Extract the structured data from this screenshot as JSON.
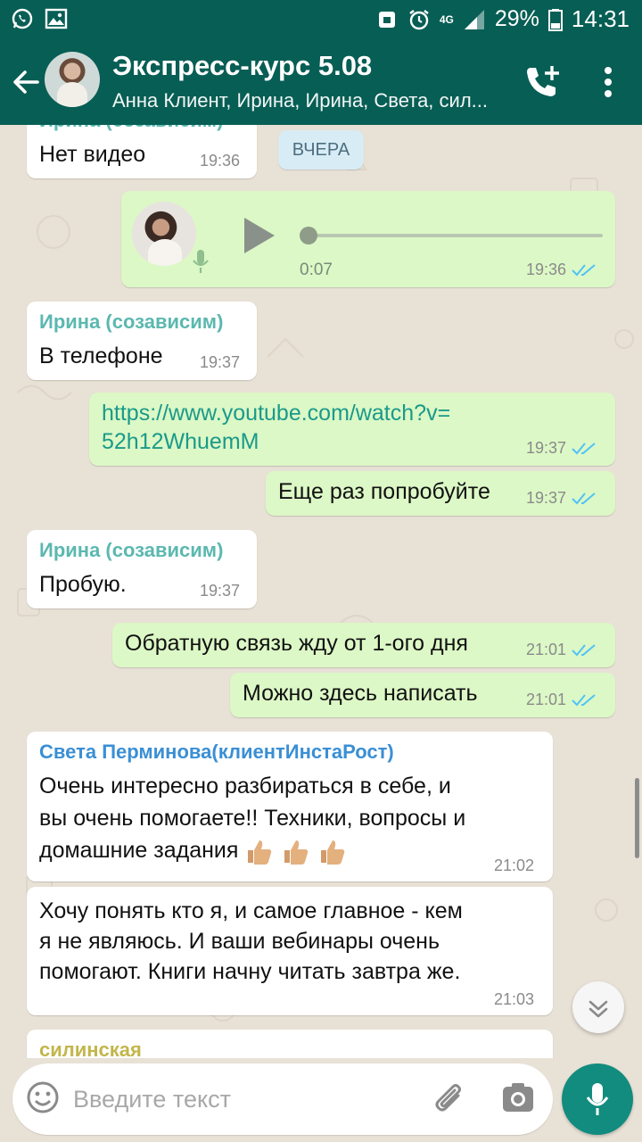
{
  "statusbar": {
    "network": "4G",
    "battery": "29%",
    "time": "14:31"
  },
  "header": {
    "title": "Экспресс-курс 5.08",
    "subtitle": "Анна Клиент, Ирина, Ирина, Света, сил..."
  },
  "date_chip": "ВЧЕРА",
  "messages": [
    {
      "type": "in",
      "sender": "Ирина (созависим)",
      "text": "Нет видео",
      "time": "19:36"
    },
    {
      "type": "out-voice",
      "duration": "0:07",
      "time": "19:36"
    },
    {
      "type": "in",
      "sender": "Ирина (созависим)",
      "text": "В телефоне",
      "time": "19:37"
    },
    {
      "type": "out",
      "text_line1": "https://www.youtube.com/watch?v=",
      "text_line2": "52h12WhuemM",
      "time": "19:37"
    },
    {
      "type": "out",
      "text": "Еще раз попробуйте",
      "time": "19:37"
    },
    {
      "type": "in",
      "sender": "Ирина (созависим)",
      "text": "Пробую.",
      "time": "19:37"
    },
    {
      "type": "out",
      "text": "Обратную связь жду от 1-ого дня",
      "time": "21:01"
    },
    {
      "type": "out",
      "text": "Можно здесь написать",
      "time": "21:01"
    },
    {
      "type": "in",
      "sender": "Света Перминова(клиентИнстаРост)",
      "line1": "Очень интересно разбираться в себе, и",
      "line2": "вы очень помогаете!! Техники, вопросы и",
      "line3": "домашние задания",
      "time": "21:02"
    },
    {
      "type": "in",
      "line1": "Хочу понять кто я, и самое главное - кем",
      "line2": "я не являюсь. И ваши вебинары очень",
      "line3": "помогают. Книги начну читать завтра же.",
      "time": "21:03"
    },
    {
      "type": "in",
      "sender": "силинская"
    }
  ],
  "colors": {
    "header": "#075e54",
    "outgoing": "#dcf8c6",
    "incoming": "#ffffff",
    "sender_irina": "#5bb8b0",
    "sender_sveta": "#3a8fd4",
    "sender_silinskaya": "#c2b64b",
    "ticks": "#4fc3f7"
  },
  "input": {
    "placeholder": "Введите текст"
  },
  "icons": [
    "whatsapp-icon",
    "gallery-icon",
    "back-arrow-icon",
    "add-call-icon",
    "more-vert-icon",
    "play-icon",
    "mic-icon",
    "emoji-icon",
    "attach-icon",
    "camera-icon",
    "chevron-down-icon",
    "thumbs-up-icon"
  ]
}
